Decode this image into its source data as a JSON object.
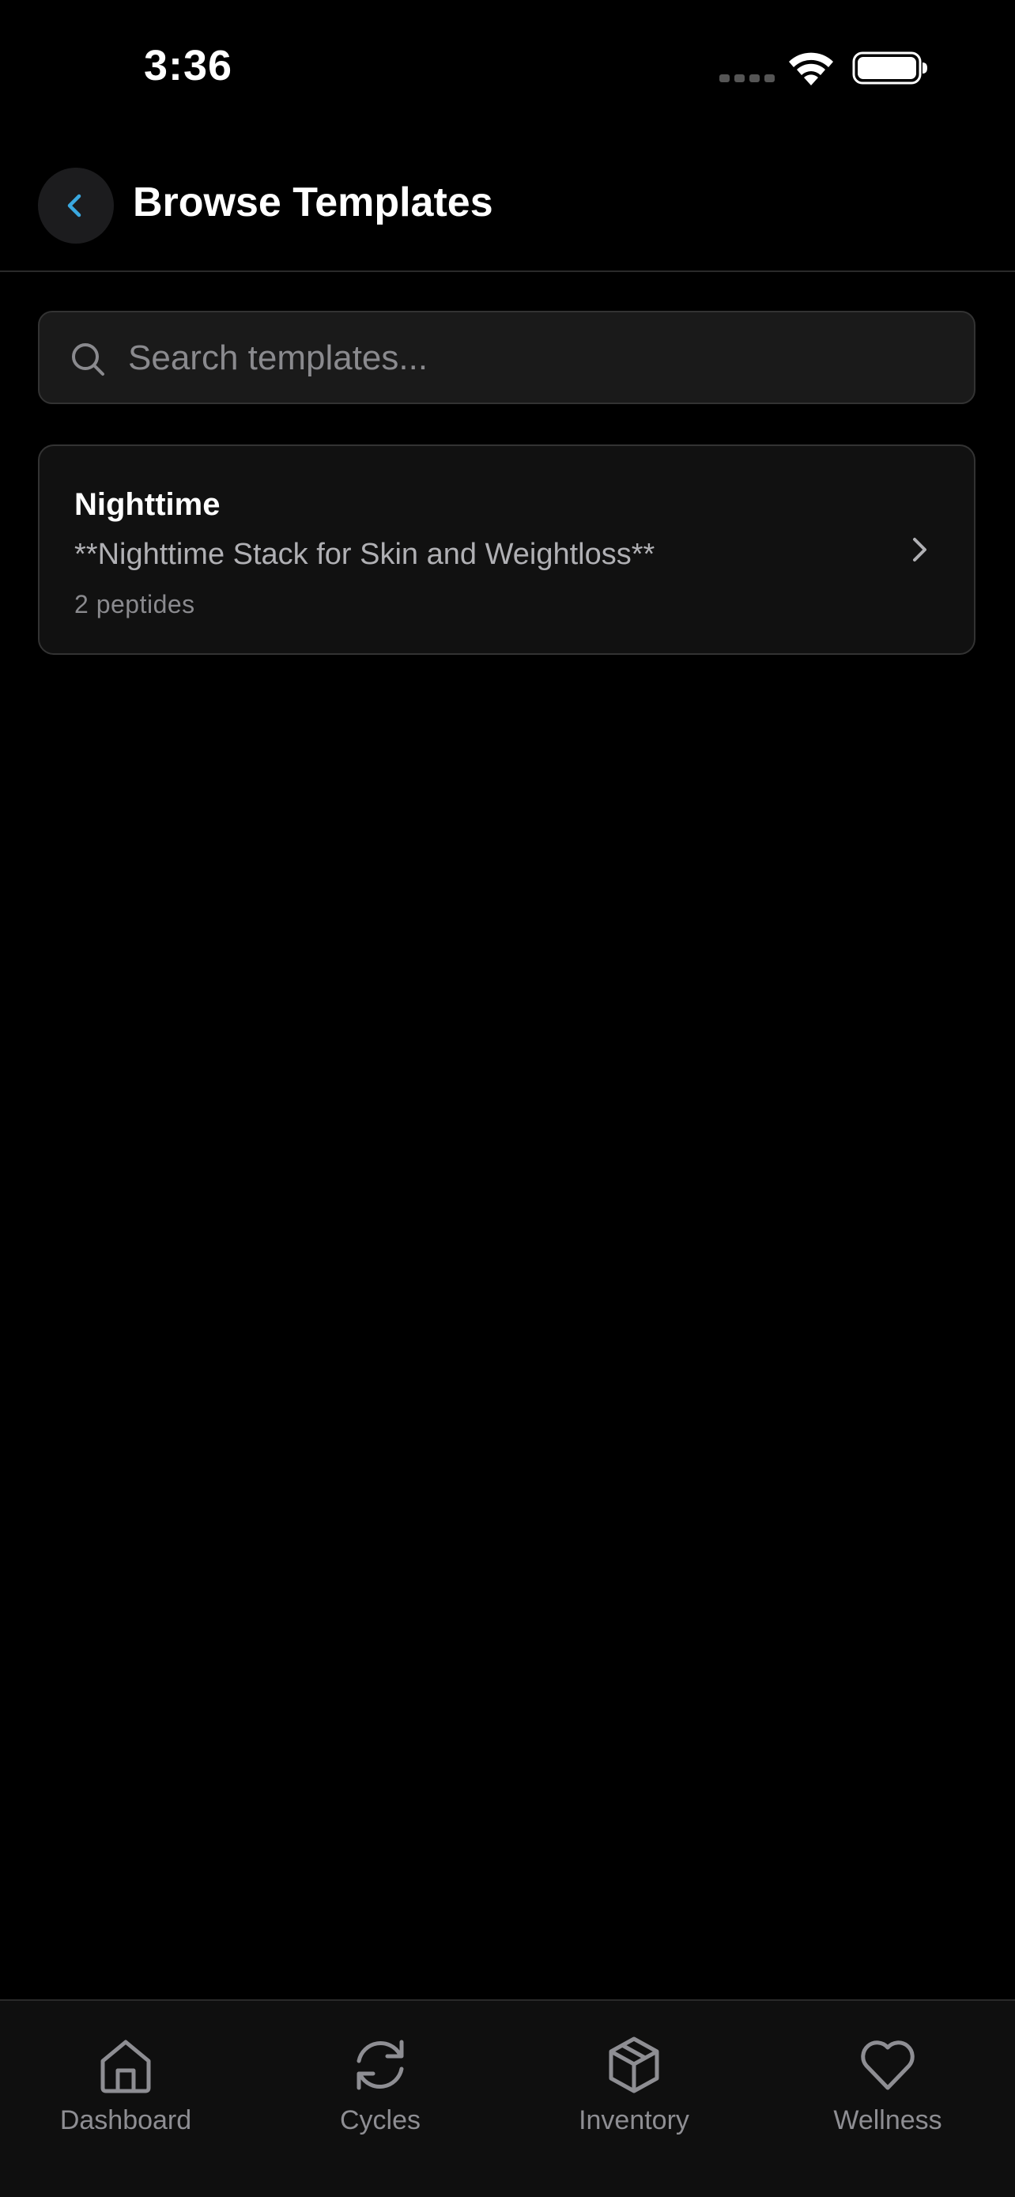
{
  "status_bar": {
    "time": "3:36"
  },
  "header": {
    "title": "Browse Templates",
    "back_icon": "chevron-left-icon",
    "accent_color": "#3aa8e0"
  },
  "search": {
    "placeholder": "Search templates...",
    "value": "",
    "icon": "search-icon"
  },
  "templates": [
    {
      "name": "Nighttime",
      "description": "**Nighttime Stack for Skin and Weightloss**",
      "count": "2 peptides"
    }
  ],
  "bottom_nav": {
    "items": [
      {
        "label": "Dashboard",
        "icon": "home-icon"
      },
      {
        "label": "Cycles",
        "icon": "refresh-icon"
      },
      {
        "label": "Inventory",
        "icon": "box-icon"
      },
      {
        "label": "Wellness",
        "icon": "heart-icon"
      }
    ]
  }
}
